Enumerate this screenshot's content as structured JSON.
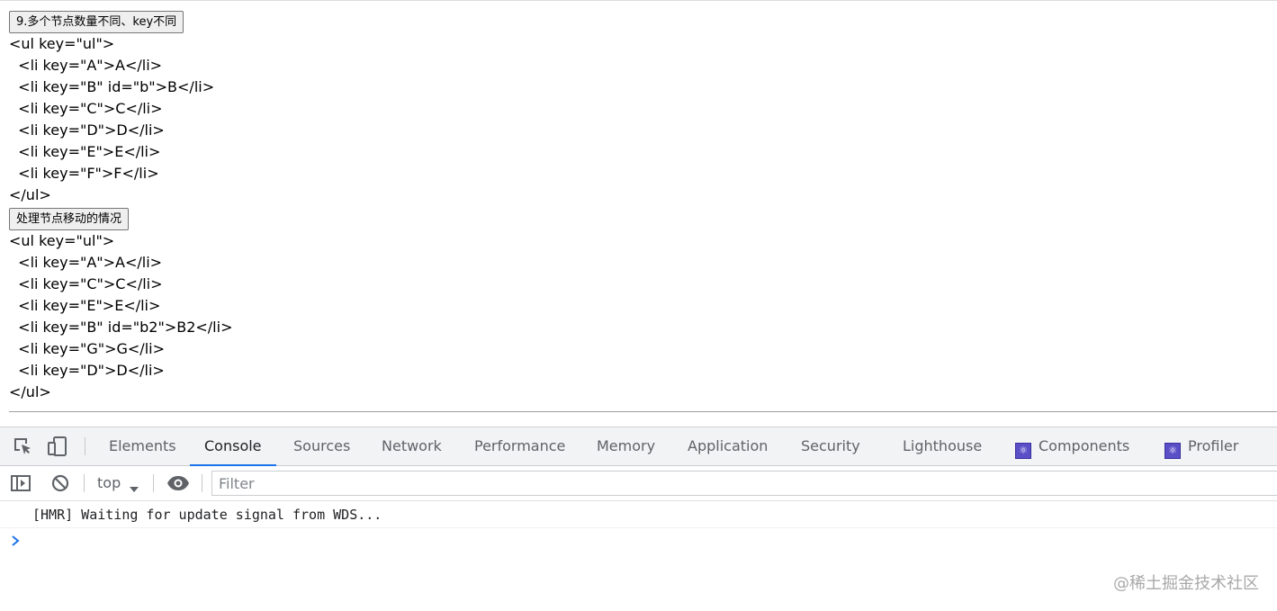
{
  "page": {
    "button1_label": "9.多个节点数量不同、key不同",
    "block1_lines": [
      "<ul key=\"ul\">",
      "  <li key=\"A\">A</li>",
      "  <li key=\"B\" id=\"b\">B</li>",
      "  <li key=\"C\">C</li>",
      "  <li key=\"D\">D</li>",
      "  <li key=\"E\">E</li>",
      "  <li key=\"F\">F</li>",
      "</ul>"
    ],
    "button2_label": "处理节点移动的情况",
    "block2_lines": [
      "<ul key=\"ul\">",
      "  <li key=\"A\">A</li>",
      "  <li key=\"C\">C</li>",
      "  <li key=\"E\">E</li>",
      "  <li key=\"B\" id=\"b2\">B2</li>",
      "  <li key=\"G\">G</li>",
      "  <li key=\"D\">D</li>",
      "</ul>"
    ]
  },
  "devtools": {
    "tabs": [
      {
        "label": "Elements"
      },
      {
        "label": "Console",
        "active": true
      },
      {
        "label": "Sources"
      },
      {
        "label": "Network"
      },
      {
        "label": "Performance"
      },
      {
        "label": "Memory"
      },
      {
        "label": "Application"
      },
      {
        "label": "Security"
      },
      {
        "label": "Lighthouse"
      },
      {
        "label": "Components",
        "icon": "react-icon"
      },
      {
        "label": "Profiler",
        "icon": "react-icon"
      }
    ],
    "toolbar": {
      "context_value": "top",
      "filter_placeholder": "Filter"
    },
    "console_messages": [
      "[HMR] Waiting for update signal from WDS..."
    ],
    "accent_color": "#1a73e8"
  },
  "watermark": "@稀土掘金技术社区"
}
